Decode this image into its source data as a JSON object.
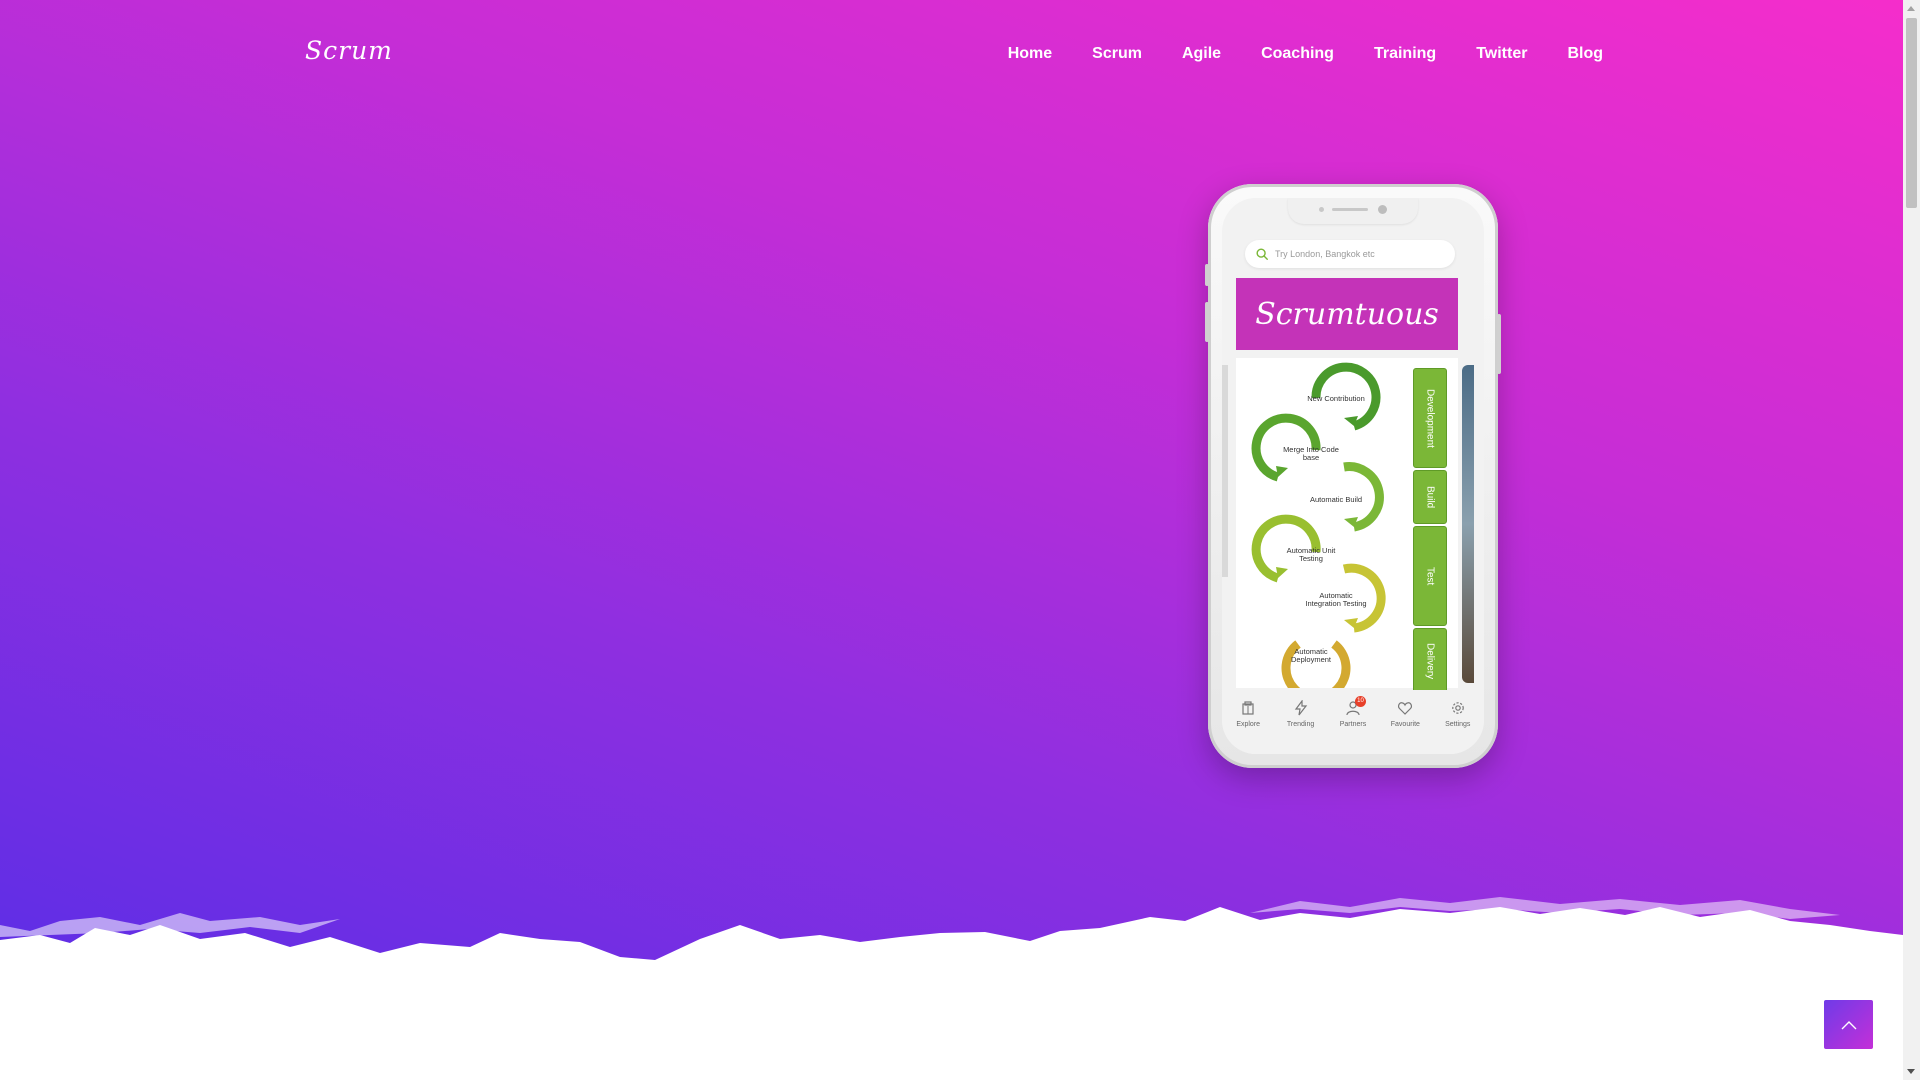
{
  "brand": {
    "logo_text": "Scrum"
  },
  "nav": {
    "items": [
      {
        "label": "Home"
      },
      {
        "label": "Scrum"
      },
      {
        "label": "Agile"
      },
      {
        "label": "Coaching"
      },
      {
        "label": "Training"
      },
      {
        "label": "Twitter"
      },
      {
        "label": "Blog"
      }
    ]
  },
  "phone": {
    "search_placeholder": "Try London, Bangkok etc",
    "banner_title": "Scrumtuous",
    "cycle_steps": [
      "New Contribution",
      "Merge Into Code base",
      "Automatic Build",
      "Automatic Unit Testing",
      "Automatic Integration Testing",
      "Automatic Deployment"
    ],
    "stages": [
      "Development",
      "Build",
      "Test",
      "Delivery"
    ],
    "tabs": [
      {
        "label": "Explore",
        "icon": "building-icon"
      },
      {
        "label": "Trending",
        "icon": "lightning-icon"
      },
      {
        "label": "Partners",
        "icon": "user-icon",
        "badge": "10"
      },
      {
        "label": "Favourite",
        "icon": "heart-icon"
      },
      {
        "label": "Settings",
        "icon": "gear-icon"
      }
    ]
  },
  "colors": {
    "gradient_start": "#5b2ee6",
    "gradient_end": "#f52dcb",
    "banner": "#c433b8",
    "stage_green": "#7bb737",
    "badge_red": "#e8402a"
  },
  "back_to_top": {
    "icon": "chevron-up-icon"
  }
}
